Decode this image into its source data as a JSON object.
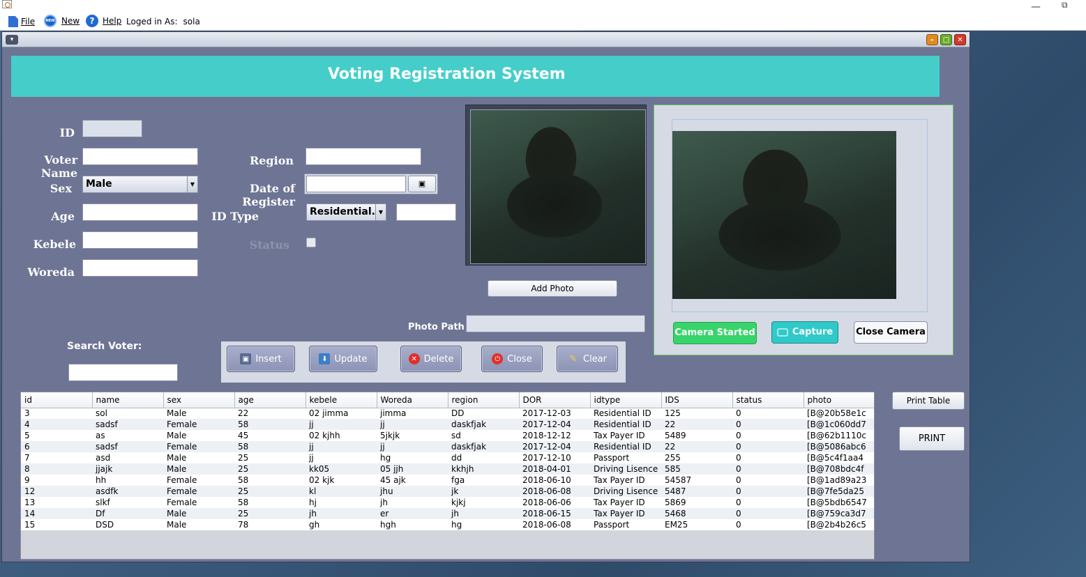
{
  "menubar": {
    "file_label": "File",
    "new_label": "New",
    "new_icon_text": "NEW",
    "help_label": "Help",
    "help_icon_text": "?",
    "logged_in_label": "Loged in As:",
    "logged_in_user": "sola"
  },
  "window_controls": {
    "minimize": "—",
    "restore": "⧉"
  },
  "frame_controls": {
    "menu": "▾",
    "min": "–",
    "max": "□",
    "close": "✕"
  },
  "banner": {
    "title": "Voting Registration System"
  },
  "form": {
    "id_label": "ID",
    "voter_name_label": "Voter Name",
    "sex_label": "Sex",
    "sex_value": "Male",
    "age_label": "Age",
    "kebele_label": "Kebele",
    "woreda_label": "Woreda",
    "region_label": "Region",
    "date_label": "Date of Register",
    "id_type_label": "ID Type",
    "id_type_value": "Residential...",
    "status_label": "Status"
  },
  "photo": {
    "add_photo_label": "Add Photo",
    "photo_path_label": "Photo Path"
  },
  "camera": {
    "started_label": "Camera Started",
    "capture_label": "Capture",
    "close_label": "Close Camera"
  },
  "search": {
    "label": "Search Voter:"
  },
  "actions": {
    "insert": "Insert",
    "update": "Update",
    "delete": "Delete",
    "close": "Close",
    "clear": "Clear"
  },
  "side_buttons": {
    "print_table": "Print Table",
    "print": "PRINT"
  },
  "colors": {
    "banner": "#45cec9",
    "frame_bg": "#6e7494",
    "camera_started": "#38d46b",
    "capture": "#2fc9c9"
  },
  "table": {
    "columns": [
      "id",
      "name",
      "sex",
      "age",
      "kebele",
      "Woreda",
      "region",
      "DOR",
      "idtype",
      "IDS",
      "status",
      "photo"
    ],
    "rows": [
      [
        "3",
        "sol",
        "Male",
        "22",
        "02 jimma",
        "jimma",
        "DD",
        "2017-12-03",
        "Residential ID",
        "125",
        "0",
        "[B@20b58e1c"
      ],
      [
        "4",
        "sadsf",
        "Female",
        "58",
        "jj",
        "jj",
        "daskfjak",
        "2017-12-04",
        "Residential ID",
        "22",
        "0",
        "[B@1c060dd7"
      ],
      [
        "5",
        "as",
        "Male",
        "45",
        "02 kjhh",
        "5jkjk",
        "sd",
        "2018-12-12",
        "Tax Payer ID",
        "5489",
        "0",
        "[B@62b1110c"
      ],
      [
        "6",
        "sadsf",
        "Female",
        "58",
        "jj",
        "jj",
        "daskfjak",
        "2017-12-04",
        "Residential ID",
        "22",
        "0",
        "[B@5086abc6"
      ],
      [
        "7",
        "asd",
        "Male",
        "25",
        "jj",
        "hg",
        "dd",
        "2017-12-10",
        "Passport",
        "255",
        "0",
        "[B@5c4f1aa4"
      ],
      [
        "8",
        "jjajk",
        "Male",
        "25",
        "kk05",
        "05 jjh",
        "kkhjh",
        "2018-04-01",
        "Driving Lisence",
        "585",
        "0",
        "[B@708bdc4f"
      ],
      [
        "9",
        "hh",
        "Female",
        "58",
        "02 kjk",
        "45 ajk",
        "fga",
        "2018-06-10",
        "Tax Payer ID",
        "54587",
        "0",
        "[B@1ad89a23"
      ],
      [
        "12",
        "asdfk",
        "Female",
        "25",
        "kl",
        "jhu",
        "jk",
        "2018-06-08",
        "Driving Lisence",
        "5487",
        "0",
        "[B@7fe5da25"
      ],
      [
        "13",
        "slkf",
        "Female",
        "58",
        "hj",
        "jh",
        "kjkj",
        "2018-06-06",
        "Tax Payer ID",
        "5869",
        "0",
        "[B@5bdb6547"
      ],
      [
        "14",
        "Df",
        "Male",
        "25",
        "jh",
        "er",
        "jh",
        "2018-06-15",
        "Tax Payer ID",
        "5468",
        "0",
        "[B@759ca3d7"
      ],
      [
        "15",
        "DSD",
        "Male",
        "78",
        "gh",
        "hgh",
        "hg",
        "2018-06-08",
        "Passport",
        "EM25",
        "0",
        "[B@2b4b26c5"
      ]
    ]
  }
}
